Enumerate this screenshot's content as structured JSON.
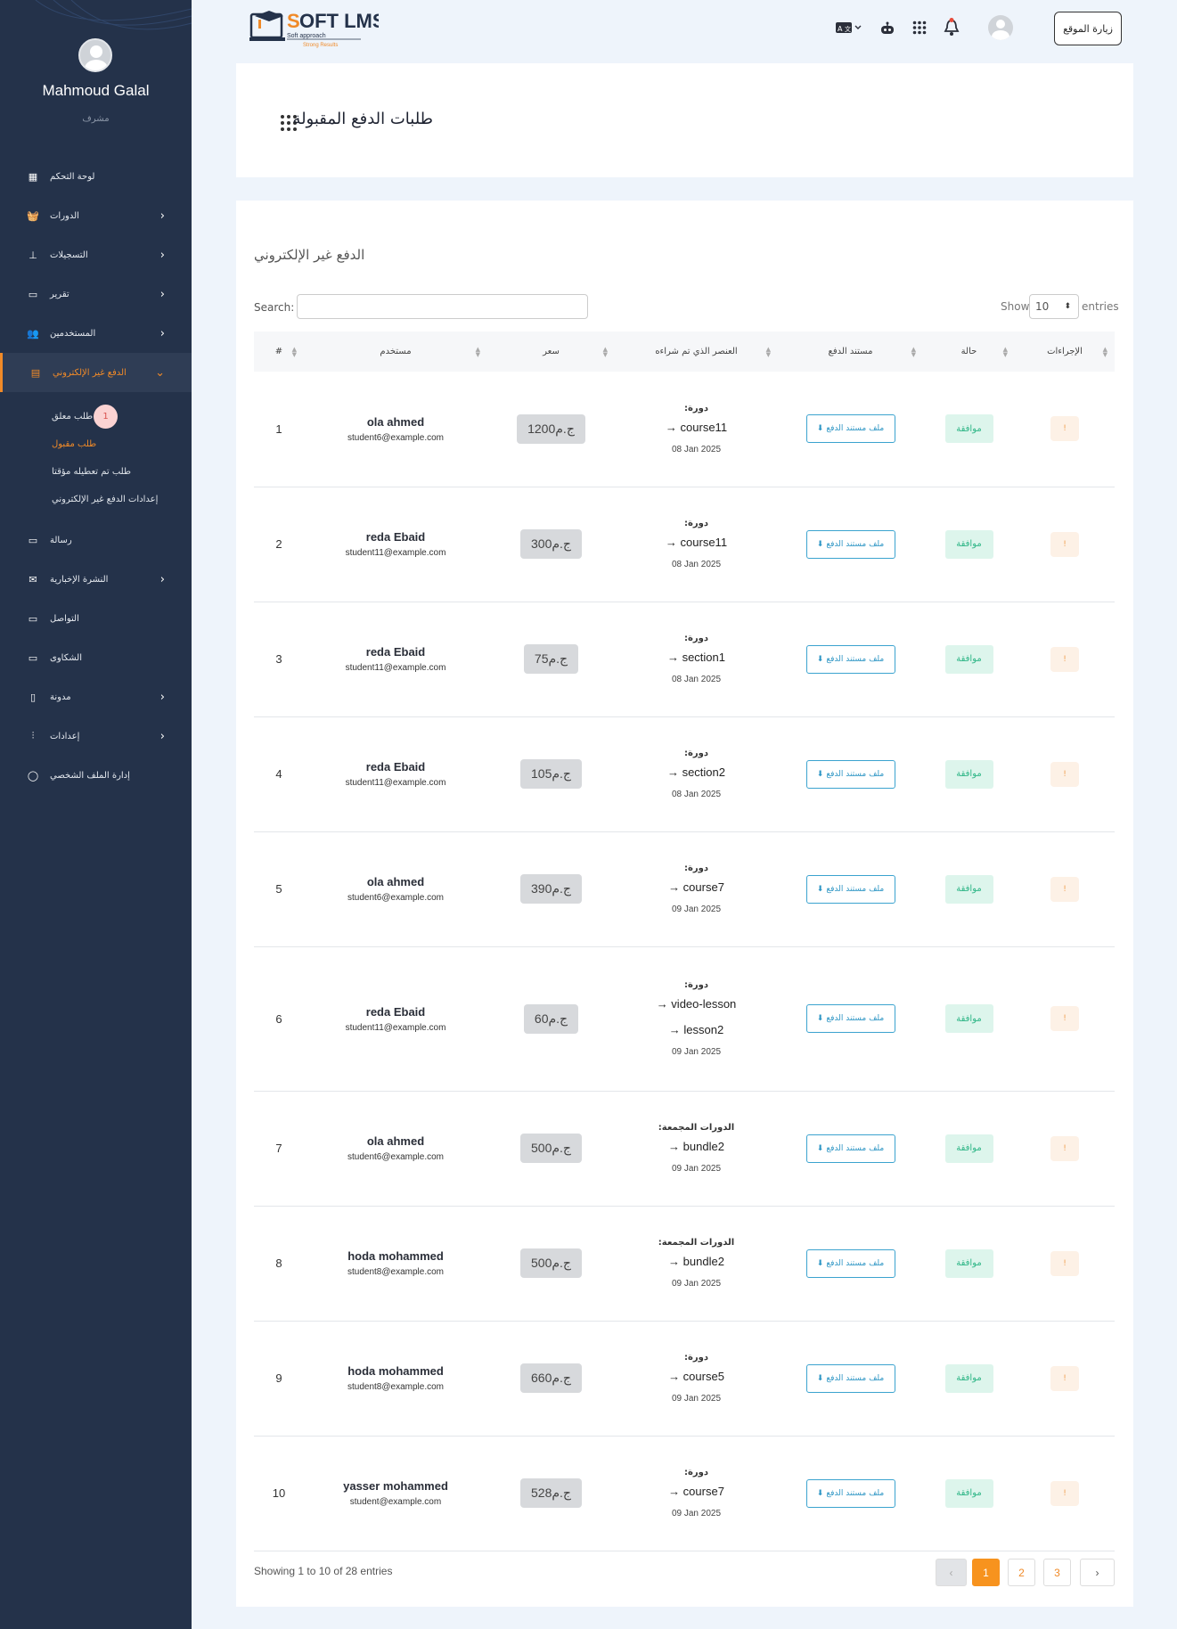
{
  "sidebar": {
    "user_name": "Mahmoud Galal",
    "user_role": "مشرف",
    "items": [
      {
        "label": "لوحة التحكم",
        "icon": "grid-icon",
        "chev": false
      },
      {
        "label": "الدورات",
        "icon": "basket-icon",
        "chev": true
      },
      {
        "label": "التسجيلات",
        "icon": "sitemap-icon",
        "chev": true
      },
      {
        "label": "تقرير",
        "icon": "archive-icon",
        "chev": true
      },
      {
        "label": "المستخدمين",
        "icon": "users-icon",
        "chev": true
      },
      {
        "label": "الدفع غير الإلكتروني",
        "icon": "store-icon",
        "chev": true,
        "active": true
      }
    ],
    "sub_items": [
      {
        "label": "طلب معلق",
        "badge": "1"
      },
      {
        "label": "طلب مقبول",
        "active": true
      },
      {
        "label": "طلب تم تعطيله مؤقتا"
      },
      {
        "label": "إعدادات الدفع غير الإلكتروني"
      }
    ],
    "items_after": [
      {
        "label": "رسالة",
        "icon": "message-icon",
        "chev": false
      },
      {
        "label": "النشرة الإخبارية",
        "icon": "envelope-open-icon",
        "chev": true
      },
      {
        "label": "التواصل",
        "icon": "contact-card-icon",
        "chev": false
      },
      {
        "label": "الشكاوى",
        "icon": "id-card-icon",
        "chev": false
      },
      {
        "label": "مدونة",
        "icon": "document-icon",
        "chev": true
      },
      {
        "label": "إعدادات",
        "icon": "sliders-icon",
        "chev": true
      },
      {
        "label": "إدارة الملف الشخصي",
        "icon": "user-icon",
        "chev": false
      }
    ]
  },
  "header": {
    "logo_text": "SOFT LMS",
    "logo_sub1": "Soft approach",
    "logo_sub2": "Strong Results",
    "visit_label": "زيارة الموقع"
  },
  "page": {
    "title": "طلبات الدفع المقبولة",
    "section_title": "الدفع غير الإلكتروني",
    "search_label": "Search:",
    "search_value": "",
    "show_label": "Show",
    "show_value": "10",
    "entries_label": "entries",
    "showing_text": "Showing 1 to 10 of 28 entries"
  },
  "table": {
    "headers": {
      "actions": "الإجراءات",
      "status": "حالة",
      "doc": "مستند الدفع",
      "item": "العنصر الذي تم شراءه",
      "price": "سعر",
      "user": "مستخدم",
      "num": "#"
    },
    "doc_button_label": "ملف مستند الدفع",
    "status_label": "موافقة",
    "action_label": "!",
    "rows": [
      {
        "num": "1",
        "name": "ola ahmed",
        "email": "student6@example.com",
        "price": "ج.م1200",
        "type": "دورة:",
        "items": [
          "→ course11"
        ],
        "date": "08 Jan 2025"
      },
      {
        "num": "2",
        "name": "reda Ebaid",
        "email": "student11@example.com",
        "price": "ج.م300",
        "type": "دورة:",
        "items": [
          "→ course11"
        ],
        "date": "08 Jan 2025"
      },
      {
        "num": "3",
        "name": "reda Ebaid",
        "email": "student11@example.com",
        "price": "ج.م75",
        "type": "دورة:",
        "items": [
          "→ section1"
        ],
        "date": "08 Jan 2025"
      },
      {
        "num": "4",
        "name": "reda Ebaid",
        "email": "student11@example.com",
        "price": "ج.م105",
        "type": "دورة:",
        "items": [
          "→ section2"
        ],
        "date": "08 Jan 2025"
      },
      {
        "num": "5",
        "name": "ola ahmed",
        "email": "student6@example.com",
        "price": "ج.م390",
        "type": "دورة:",
        "items": [
          "→ course7"
        ],
        "date": "09 Jan 2025"
      },
      {
        "num": "6",
        "name": "reda Ebaid",
        "email": "student11@example.com",
        "price": "ج.م60",
        "type": "دورة:",
        "items": [
          "→ video-lesson",
          "→ lesson2"
        ],
        "date": "09 Jan 2025"
      },
      {
        "num": "7",
        "name": "ola ahmed",
        "email": "student6@example.com",
        "price": "ج.م500",
        "type": "الدورات المجمعة:",
        "items": [
          "→ bundle2"
        ],
        "date": "09 Jan 2025"
      },
      {
        "num": "8",
        "name": "hoda mohammed",
        "email": "student8@example.com",
        "price": "ج.م500",
        "type": "الدورات المجمعة:",
        "items": [
          "→ bundle2"
        ],
        "date": "09 Jan 2025"
      },
      {
        "num": "9",
        "name": "hoda mohammed",
        "email": "student8@example.com",
        "price": "ج.م660",
        "type": "دورة:",
        "items": [
          "→ course5"
        ],
        "date": "09 Jan 2025"
      },
      {
        "num": "10",
        "name": "yasser mohammed",
        "email": "student@example.com",
        "price": "ج.م528",
        "type": "دورة:",
        "items": [
          "→ course7"
        ],
        "date": "09 Jan 2025"
      }
    ]
  },
  "pagination": {
    "prev": "‹",
    "pages": [
      "1",
      "2",
      "3"
    ],
    "next": "›",
    "active": "1"
  },
  "colors": {
    "sidebar_bg": "#24324a",
    "accent": "#f08a28",
    "status_bg": "#ddf5ec",
    "status_text": "#2fb687",
    "doc_button": "#2c95c4"
  }
}
